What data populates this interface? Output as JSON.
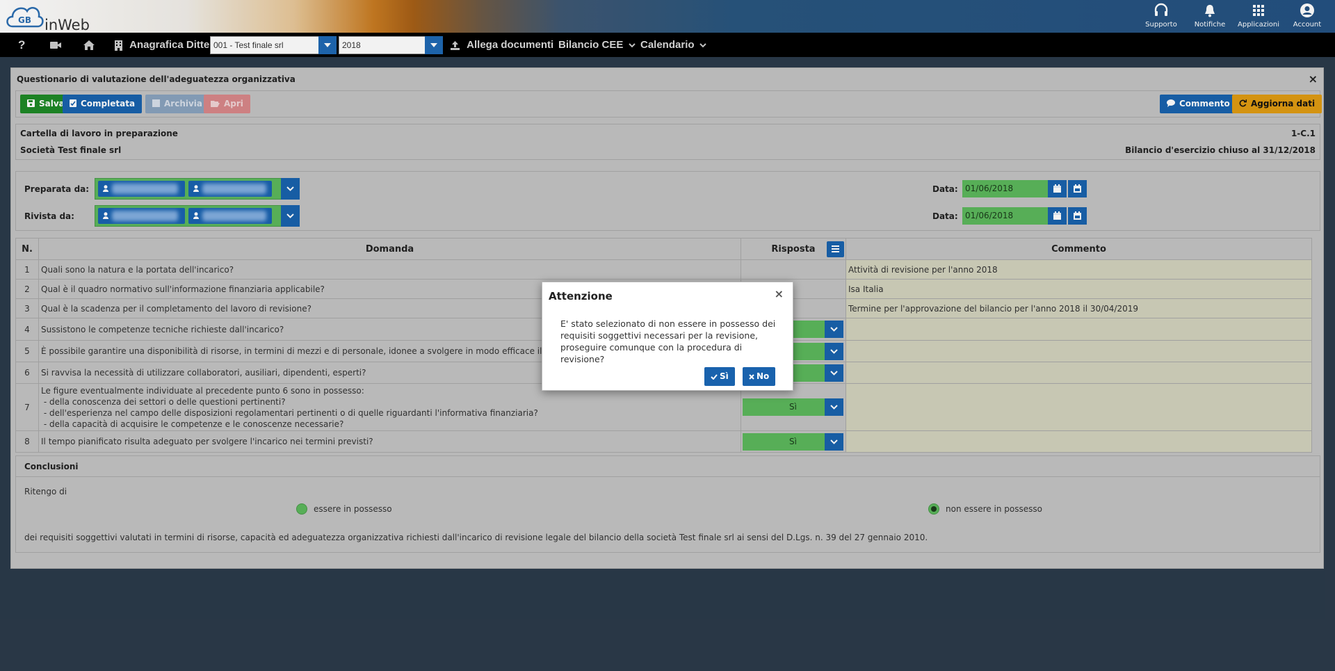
{
  "brand": {
    "logo_text": "inWeb",
    "logo_mark": "GB"
  },
  "top_actions": [
    {
      "label": "Supporto",
      "icon": "headset-icon"
    },
    {
      "label": "Notifiche",
      "icon": "bell-icon"
    },
    {
      "label": "Applicazioni",
      "icon": "grid-icon"
    },
    {
      "label": "Account",
      "icon": "user-circle-icon"
    }
  ],
  "nav": {
    "help": "?",
    "company_label": "Anagrafica Ditte",
    "company_value": "001 - Test finale srl",
    "year_value": "2018",
    "attach_label": "Allega documenti",
    "bilancio_label": "Bilancio CEE",
    "calendar_label": "Calendario"
  },
  "panel": {
    "title": "Questionario di valutazione dell'adeguatezza organizzativa",
    "close": "×",
    "buttons": {
      "save": "Salva",
      "complete": "Completata",
      "archive": "Archivia",
      "open": "Apri",
      "comment": "Commento",
      "refresh": "Aggiorna dati"
    },
    "info": {
      "folder_status": "Cartella di lavoro in preparazione",
      "code": "1-C.1",
      "company": "Società Test finale srl",
      "fiscal_year": "Bilancio d'esercizio chiuso al 31/12/2018"
    },
    "signoff": {
      "prepared_label": "Preparata da:",
      "reviewed_label": "Rivista da:",
      "date_label": "Data:",
      "prepared_date": "01/06/2018",
      "reviewed_date": "01/06/2018"
    }
  },
  "table": {
    "headers": {
      "num": "N.",
      "question": "Domanda",
      "answer": "Risposta",
      "comment": "Commento"
    },
    "rows": [
      {
        "n": "1",
        "q": "Quali sono la natura e la portata dell'incarico?",
        "a": "",
        "c": "Attività di revisione per l'anno 2018"
      },
      {
        "n": "2",
        "q": "Qual è il quadro normativo sull'informazione finanziaria applicabile?",
        "a": "",
        "c": "Isa Italia"
      },
      {
        "n": "3",
        "q": "Qual è la scadenza per il completamento del lavoro di revisione?",
        "a": "",
        "c": "Termine per l'approvazione del bilancio per l'anno 2018 il 30/04/2019"
      },
      {
        "n": "4",
        "q": "Sussistono le competenze tecniche richieste dall'incarico?",
        "a": "",
        "c": ""
      },
      {
        "n": "5",
        "q": "È possibile garantire una disponibilità di risorse, in termini di mezzi e di personale, idonee a svolgere in modo efficace il lavoro proposto?",
        "a": "",
        "c": ""
      },
      {
        "n": "6",
        "q": "Si ravvisa la necessità di utilizzare collaboratori, ausiliari, dipendenti, esperti?",
        "a": "",
        "c": ""
      },
      {
        "n": "7",
        "q_lines": [
          "Le figure eventualmente individuate al precedente punto 6 sono in possesso:",
          " - della conoscenza dei settori o delle questioni pertinenti?",
          " - dell'esperienza nel campo delle disposizioni regolamentari pertinenti o di quelle riguardanti l'informativa finanziaria?",
          " - della capacità di acquisire le competenze e le conoscenze necessarie?"
        ],
        "a": "Sì",
        "c": ""
      },
      {
        "n": "8",
        "q": "Il tempo pianificato risulta adeguato per svolgere l'incarico nei termini previsti?",
        "a": "Sì",
        "c": ""
      }
    ]
  },
  "conclusions": {
    "title": "Conclusioni",
    "intro": "Ritengo di",
    "option_yes": "essere in possesso",
    "option_no": "non essere in possesso",
    "selected": "non essere in possesso",
    "footer": "dei requisiti soggettivi valutati in termini di risorse, capacità ed adeguatezza organizzativa richiesti dall'incarico di revisione legale del bilancio della società Test finale srl ai sensi del D.Lgs. n. 39 del 27 gennaio 2010."
  },
  "modal": {
    "title": "Attenzione",
    "close": "×",
    "message": "E' stato selezionato di non essere in possesso dei requisiti soggettivi necessari per la revisione, proseguire comunque con la procedura di revisione?",
    "yes": "Sì",
    "no": "No"
  },
  "colors": {
    "primary": "#1962ad",
    "success": "#5cb85c",
    "save": "#1e8a26",
    "warning": "#e09b12",
    "panel_bg": "#c3c3c3",
    "page_bg": "#2b3a4a",
    "comment_cell": "#d2d2bd"
  }
}
